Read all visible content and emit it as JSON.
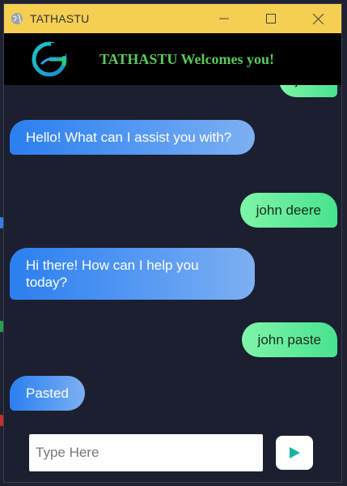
{
  "window": {
    "title": "TATHASTU"
  },
  "header": {
    "title": "TATHASTU Welcomes you!"
  },
  "chat": {
    "messages": [
      {
        "role": "user",
        "text": "john"
      },
      {
        "role": "bot",
        "text": "Hello! What can I assist you with?"
      },
      {
        "role": "user",
        "text": "john deere"
      },
      {
        "role": "bot",
        "text": "Hi there! How can I help you today?"
      },
      {
        "role": "user",
        "text": "john paste"
      },
      {
        "role": "bot",
        "text": "Pasted"
      }
    ]
  },
  "composer": {
    "placeholder": "Type Here",
    "value": ""
  },
  "colors": {
    "titlebar": "#f4cf52",
    "header_text": "#5ac85a",
    "chat_bg": "#1c1f30",
    "bot_bubble": "#2b7ff0",
    "user_bubble": "#48e28f",
    "send_icon": "#16b3a0"
  },
  "icons": {
    "app": "globe-icon",
    "minimize": "minimize-icon",
    "maximize": "maximize-icon",
    "close": "close-icon",
    "logo": "g-logo-icon",
    "send": "send-icon"
  }
}
